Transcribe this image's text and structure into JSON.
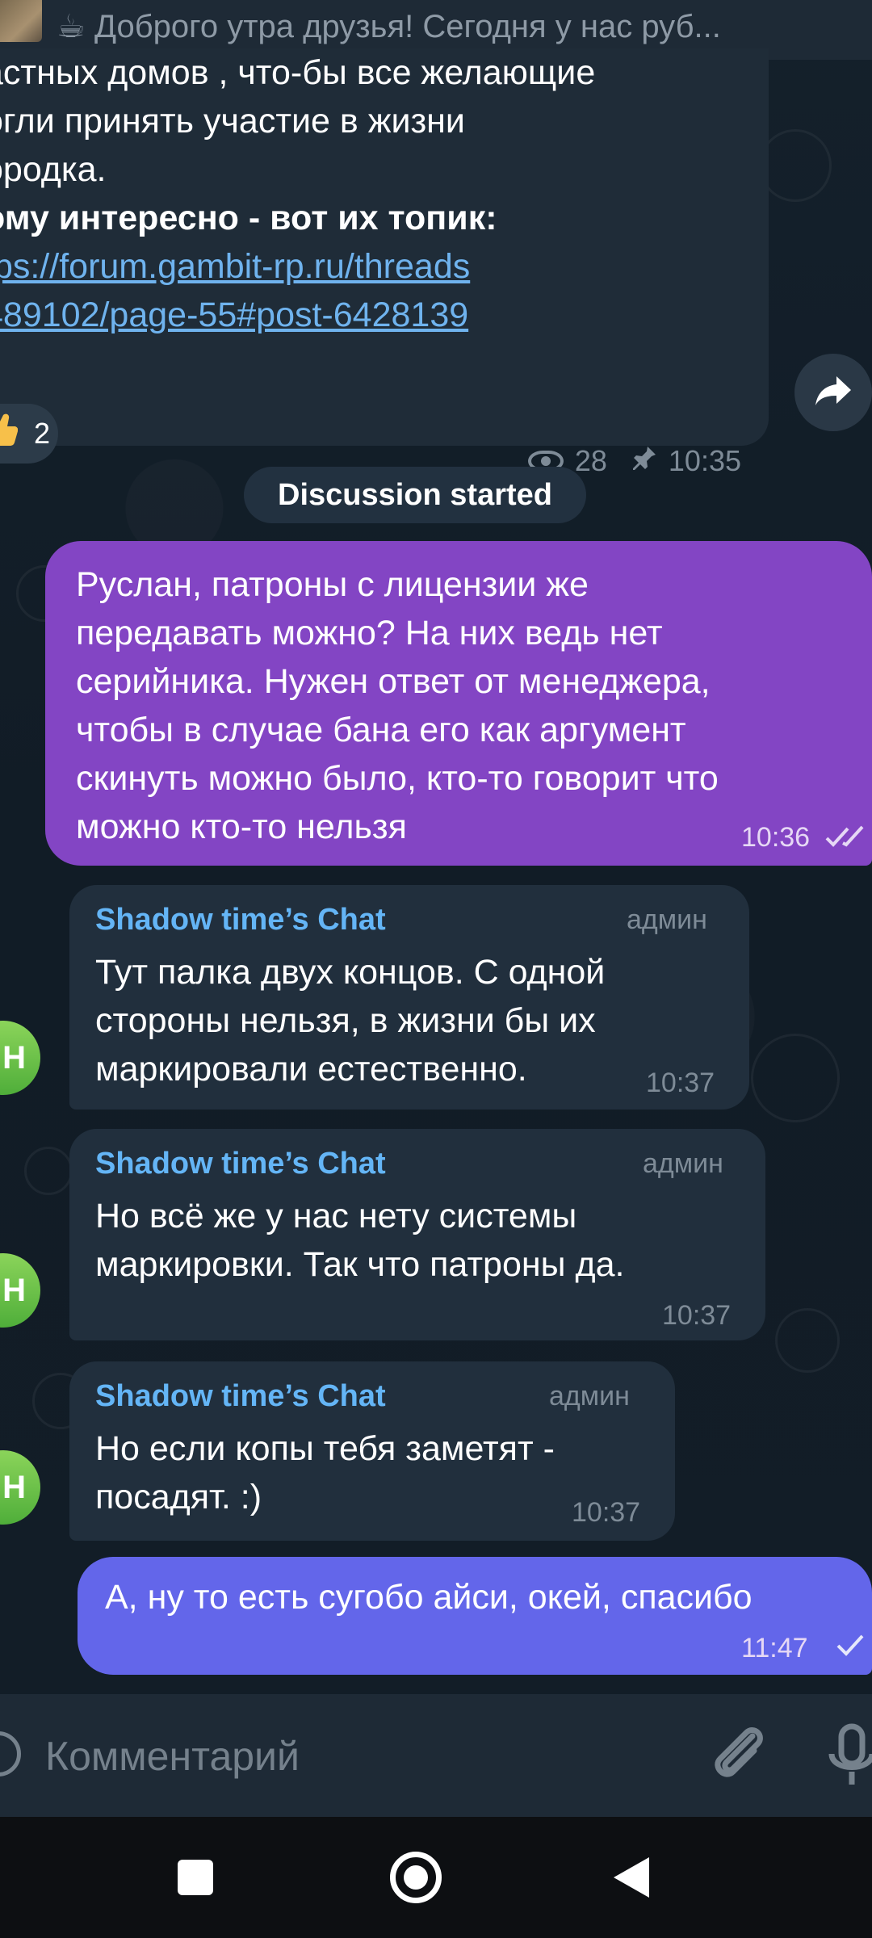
{
  "pinned": {
    "text": "☕ Доброго утра друзья! Сегодня у нас руб..."
  },
  "post": {
    "lines": [
      "астных домов , что-бы все желающие",
      "огли принять участие в жизни",
      "ородка."
    ],
    "bold_line": "ому интересно - вот их топик:",
    "link_lines": [
      "tps://forum.gambit-rp.ru/threads",
      "489102/page-55#post-6428139"
    ],
    "reaction": {
      "icon": "thumbs-up-icon",
      "count": "2"
    },
    "views": "28",
    "time": "10:35"
  },
  "service_message": "Discussion started",
  "messages": {
    "out1": {
      "lines": [
        "Руслан, патроны с лицензии же",
        "передавать можно? На них ведь нет",
        "серийника. Нужен ответ от менеджера,",
        "чтобы в случае бана его как аргумент",
        "скинуть можно было, кто-то говорит что",
        "можно кто-то нельзя"
      ],
      "time": "10:36"
    },
    "in1": {
      "name": "Shadow time’s Chat",
      "role": "админ",
      "lines": [
        "Тут палка двух концов.  С одной",
        "стороны нельзя, в жизни бы их",
        "маркировали естественно."
      ],
      "time": "10:37"
    },
    "in2": {
      "name": "Shadow time’s Chat",
      "role": "админ",
      "lines": [
        "Но всё же у нас нету системы",
        "маркировки. Так что патроны да."
      ],
      "time": "10:37"
    },
    "in3": {
      "name": "Shadow time’s Chat",
      "role": "админ",
      "lines": [
        "Но если копы тебя заметят -",
        "посадят. :)"
      ],
      "time": "10:37"
    },
    "out2": {
      "text": "А, ну то есть сугобо айси, окей, спасибо",
      "time": "11:47"
    },
    "avatar_letter": "Н"
  },
  "input": {
    "placeholder": "Комментарий"
  },
  "colors": {
    "outgoing_bubble": "#8345c4",
    "outgoing_bubble_2": "#6366ea",
    "incoming_bubble": "#212f3d",
    "sender_name": "#64b5f6",
    "link": "#6fb3ee"
  }
}
